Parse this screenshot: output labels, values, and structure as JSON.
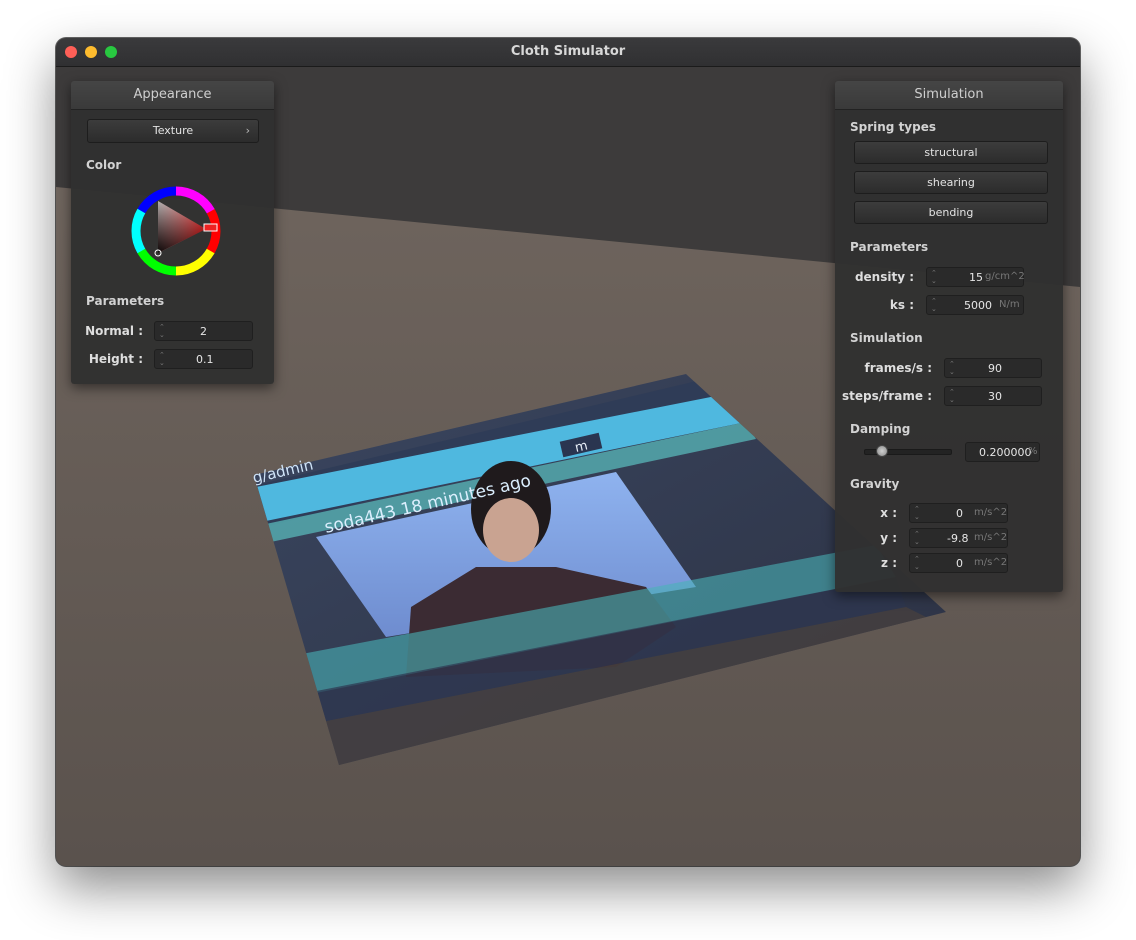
{
  "window": {
    "title": "Cloth Simulator"
  },
  "appearance": {
    "header": "Appearance",
    "texture_button": "Texture",
    "color_label": "Color",
    "parameters_label": "Parameters",
    "normal_label": "Normal :",
    "normal_value": "2",
    "height_label": "Height :",
    "height_value": "0.1"
  },
  "simulation_panel": {
    "header": "Simulation",
    "spring_types_label": "Spring types",
    "spring_buttons": [
      "structural",
      "shearing",
      "bending"
    ],
    "parameters_label": "Parameters",
    "density_label": "density :",
    "density_value": "15",
    "density_unit": "g/cm^2",
    "ks_label": "ks :",
    "ks_value": "5000",
    "ks_unit": "N/m",
    "simulation_label": "Simulation",
    "fps_label": "frames/s :",
    "fps_value": "90",
    "steps_label": "steps/frame :",
    "steps_value": "30",
    "damping_label": "Damping",
    "damping_value": "0.200000",
    "damping_unit": "%",
    "damping_fraction": 0.2,
    "gravity_label": "Gravity",
    "gx_label": "x :",
    "gx_value": "0",
    "gy_label": "y :",
    "gy_value": "-9.8",
    "gz_label": "z :",
    "gz_value": "0",
    "gravity_unit": "m/s^2"
  },
  "cloth_texture": {
    "url_fragment": "g/admin",
    "caption": "soda443 18 minutes ago",
    "tag": "m"
  }
}
